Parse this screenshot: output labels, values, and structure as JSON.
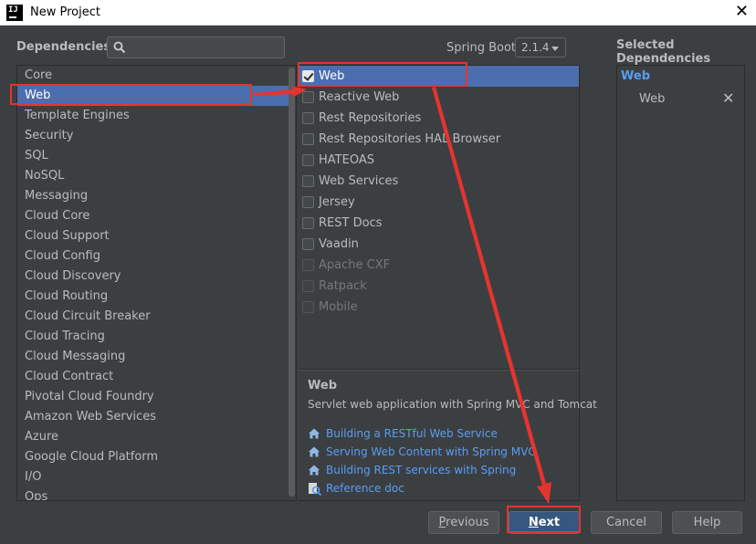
{
  "window": {
    "title": "New Project",
    "app_icon_text": "IJ"
  },
  "header": {
    "dependencies_label": "Dependencies",
    "search_placeholder": "",
    "spring_boot_label": "Spring Boot",
    "spring_boot_version": "2.1.4",
    "selected_dependencies_label": "Selected Dependencies"
  },
  "categories": [
    "Core",
    "Web",
    "Template Engines",
    "Security",
    "SQL",
    "NoSQL",
    "Messaging",
    "Cloud Core",
    "Cloud Support",
    "Cloud Config",
    "Cloud Discovery",
    "Cloud Routing",
    "Cloud Circuit Breaker",
    "Cloud Tracing",
    "Cloud Messaging",
    "Cloud Contract",
    "Pivotal Cloud Foundry",
    "Amazon Web Services",
    "Azure",
    "Google Cloud Platform",
    "I/O",
    "Ops"
  ],
  "selected_category": "Web",
  "dependencies": [
    {
      "label": "Web",
      "checked": true,
      "enabled": true
    },
    {
      "label": "Reactive Web",
      "checked": false,
      "enabled": true
    },
    {
      "label": "Rest Repositories",
      "checked": false,
      "enabled": true
    },
    {
      "label": "Rest Repositories HAL Browser",
      "checked": false,
      "enabled": true
    },
    {
      "label": "HATEOAS",
      "checked": false,
      "enabled": true
    },
    {
      "label": "Web Services",
      "checked": false,
      "enabled": true
    },
    {
      "label": "Jersey",
      "checked": false,
      "enabled": true
    },
    {
      "label": "REST Docs",
      "checked": false,
      "enabled": true
    },
    {
      "label": "Vaadin",
      "checked": false,
      "enabled": true
    },
    {
      "label": "Apache CXF",
      "checked": false,
      "enabled": false
    },
    {
      "label": "Ratpack",
      "checked": false,
      "enabled": false
    },
    {
      "label": "Mobile",
      "checked": false,
      "enabled": false
    }
  ],
  "description": {
    "title": "Web",
    "text": "Servlet web application with Spring MVC and Tomcat",
    "links": [
      {
        "label": "Building a RESTful Web Service",
        "icon": "home-icon"
      },
      {
        "label": "Serving Web Content with Spring MVC",
        "icon": "home-icon"
      },
      {
        "label": "Building REST services with Spring",
        "icon": "home-icon"
      },
      {
        "label": "Reference doc",
        "icon": "doc-search-icon"
      }
    ]
  },
  "selected_dependencies": {
    "group": "Web",
    "items": [
      {
        "label": "Web",
        "remove": "✕"
      }
    ]
  },
  "buttons": {
    "previous": {
      "mnemonic": "P",
      "rest": "revious"
    },
    "next": {
      "mnemonic": "N",
      "rest": "ext"
    },
    "cancel": "Cancel",
    "help": "Help"
  },
  "colors": {
    "background": "#3c3f41",
    "selection": "#4b6eaf",
    "link": "#589df6",
    "annotation": "#e5342f"
  }
}
